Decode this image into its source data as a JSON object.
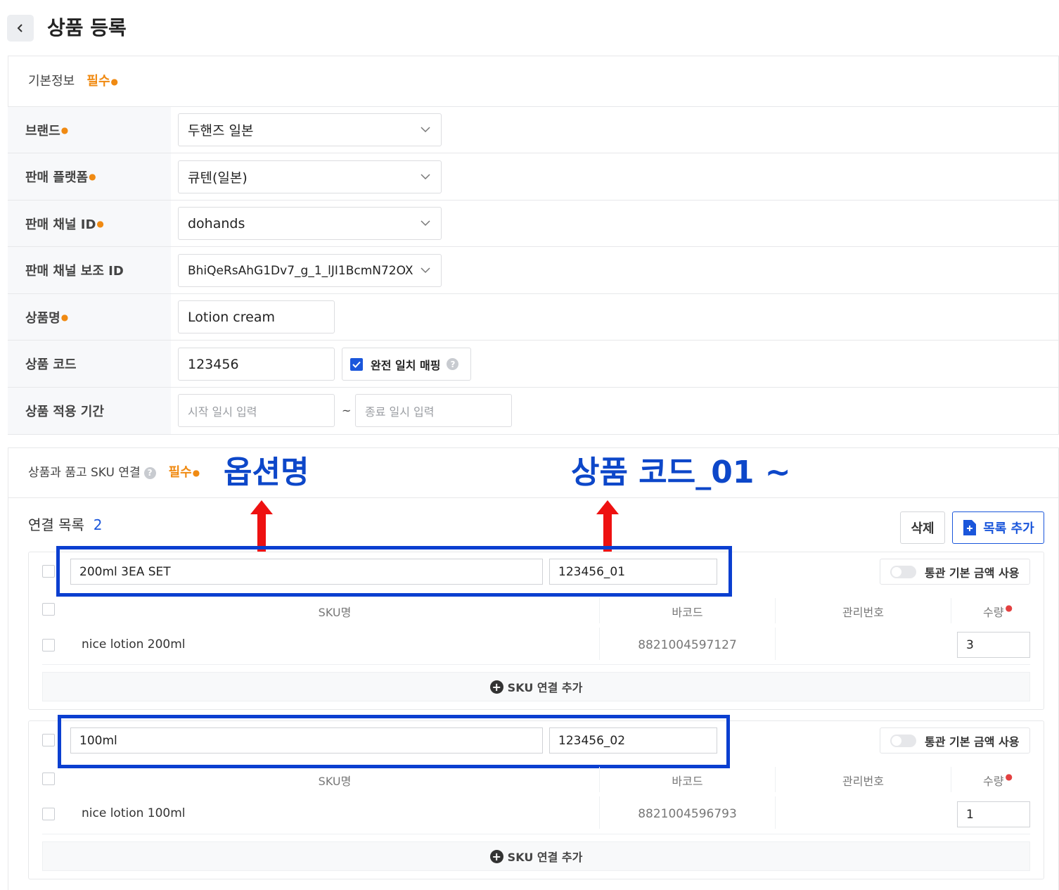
{
  "header": {
    "title": "상품 등록"
  },
  "basic": {
    "title": "기본정보",
    "required": "필수",
    "rows": {
      "brand": {
        "label": "브랜드",
        "value": "두핸즈 일본"
      },
      "platform": {
        "label": "판매 플랫폼",
        "value": "큐텐(일본)"
      },
      "channel_id": {
        "label": "판매 채널 ID",
        "value": "dohands"
      },
      "sub_id": {
        "label": "판매 채널 보조 ID",
        "value": "BhiQeRsAhG1Dv7_g_1_lJI1BcmN72OX"
      },
      "name": {
        "label": "상품명",
        "value": "Lotion cream"
      },
      "code": {
        "label": "상품 코드",
        "value": "123456",
        "exact_match": "완전 일치 매핑"
      },
      "period": {
        "label": "상품 적용 기간",
        "start_placeholder": "시작 일시 입력",
        "tilde": "~",
        "end_placeholder": "종료 일시 입력"
      }
    }
  },
  "sku": {
    "title": "상품과 품고 SKU 연결",
    "required": "필수",
    "list_label": "연결 목록",
    "list_count": "2",
    "delete_label": "삭제",
    "add_list_label": "목록 추가",
    "columns": {
      "sku_name": "SKU명",
      "barcode": "바코드",
      "mgmt_no": "관리번호",
      "qty": "수량"
    },
    "toggle_label": "통관 기본 금액 사용",
    "add_sku_label": "SKU 연결 추가",
    "groups": [
      {
        "option_name": "200ml 3EA SET",
        "product_code": "123456_01",
        "sku_name": "nice lotion 200ml",
        "barcode": "8821004597127",
        "qty": "3"
      },
      {
        "option_name": "100ml",
        "product_code": "123456_02",
        "sku_name": "nice lotion 100ml",
        "barcode": "8821004596793",
        "qty": "1"
      }
    ]
  },
  "annotations": {
    "option_name": "옵션명",
    "product_code": "상품 코드_01 ~"
  },
  "colors": {
    "accent": "#1a56db",
    "required": "#f08a12",
    "annotation": "#0d47c9",
    "arrow": "#ee1111"
  }
}
